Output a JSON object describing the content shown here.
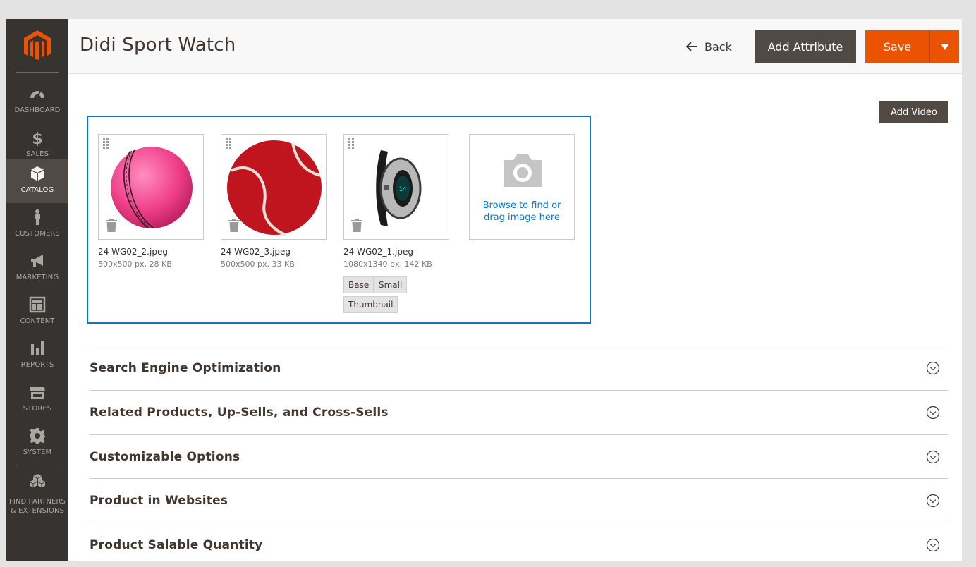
{
  "header": {
    "title": "Didi Sport Watch",
    "back_label": "Back",
    "add_attribute_label": "Add Attribute",
    "save_label": "Save"
  },
  "sidebar": {
    "items": [
      {
        "label": "DASHBOARD",
        "icon": "dashboard-icon"
      },
      {
        "label": "SALES",
        "icon": "dollar-icon"
      },
      {
        "label": "CATALOG",
        "icon": "box-icon",
        "active": true
      },
      {
        "label": "CUSTOMERS",
        "icon": "person-icon"
      },
      {
        "label": "MARKETING",
        "icon": "megaphone-icon"
      },
      {
        "label": "CONTENT",
        "icon": "layout-icon"
      },
      {
        "label": "REPORTS",
        "icon": "bar-chart-icon"
      },
      {
        "label": "STORES",
        "icon": "storefront-icon"
      },
      {
        "label": "SYSTEM",
        "icon": "gear-icon"
      },
      {
        "label1": "FIND PARTNERS",
        "label2": "& EXTENSIONS",
        "icon": "cubes-icon"
      }
    ]
  },
  "gallery": {
    "add_video_label": "Add Video",
    "images": [
      {
        "name": "24-WG02_2.jpeg",
        "meta": "500x500 px, 28 KB",
        "thumb": "pink-cricket-ball"
      },
      {
        "name": "24-WG02_3.jpeg",
        "meta": "500x500 px, 33 KB",
        "thumb": "red-tennis-ball"
      },
      {
        "name": "24-WG02_1.jpeg",
        "meta": "1080x1340 px, 142 KB",
        "thumb": "sport-watch",
        "roles": [
          "Base",
          "Small",
          "Thumbnail"
        ]
      }
    ],
    "upload": {
      "line1": "Browse to find or",
      "line2": "drag image here"
    }
  },
  "sections": [
    "Search Engine Optimization",
    "Related Products, Up-Sells, and Cross-Sells",
    "Customizable Options",
    "Product in Websites",
    "Product Salable Quantity"
  ],
  "colors": {
    "accent": "#eb5202",
    "sidebar": "#373330",
    "dark_button": "#514943",
    "link": "#007bdb"
  }
}
